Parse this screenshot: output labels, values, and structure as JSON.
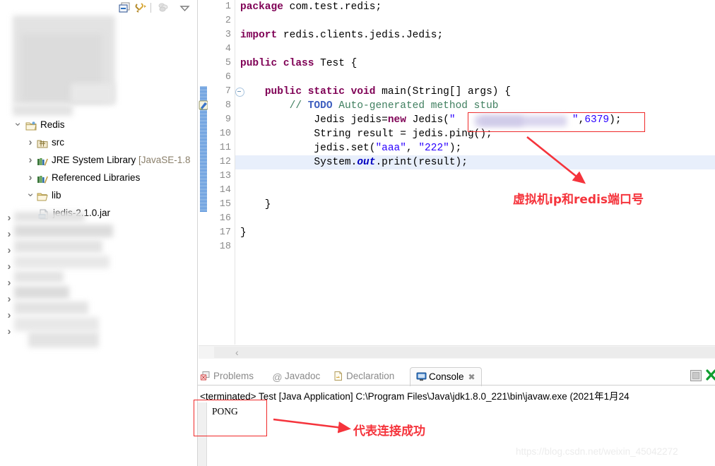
{
  "explorer": {
    "toolbar": [
      {
        "name": "collapse-all-icon",
        "title": "Collapse All"
      },
      {
        "name": "link-with-editor-icon",
        "title": "Link with Editor"
      },
      {
        "name": "filter-icon",
        "title": "Filters"
      },
      {
        "name": "view-menu-icon",
        "title": "View Menu"
      }
    ],
    "tree": [
      {
        "label": "",
        "icon": "folder-icon",
        "state": "redacted",
        "indent": 0,
        "redacted": true
      },
      {
        "label": "",
        "icon": "folder-icon",
        "state": "redacted",
        "indent": 0,
        "redacted": true
      },
      {
        "label": "",
        "icon": "folder-icon",
        "state": "redacted",
        "indent": 0,
        "redacted": true
      },
      {
        "label": "",
        "icon": "folder-icon",
        "state": "redacted",
        "indent": 0,
        "redacted": true
      },
      {
        "label": "",
        "icon": "folder-icon",
        "state": "redacted",
        "indent": 0,
        "redacted": true
      },
      {
        "label": "Redis",
        "icon": "java-project-icon",
        "state": "open",
        "indent": 0,
        "redacted": false
      },
      {
        "label": "src",
        "icon": "source-folder-icon",
        "state": "closed",
        "indent": 1,
        "redacted": false
      },
      {
        "label": "JRE System Library",
        "suffix": " [JavaSE-1.8",
        "icon": "library-icon",
        "state": "closed",
        "indent": 1,
        "redacted": false
      },
      {
        "label": "Referenced Libraries",
        "icon": "library-icon",
        "state": "closed",
        "indent": 1,
        "redacted": false
      },
      {
        "label": "lib",
        "icon": "folder-open-icon",
        "state": "open",
        "indent": 1,
        "redacted": false
      },
      {
        "label": "jedis-2.1.0.jar",
        "icon": "jar-icon",
        "state": "leaf",
        "indent": 2,
        "redacted": false
      },
      {
        "label": "",
        "icon": "folder-icon",
        "state": "closed",
        "indent": 0,
        "redacted": true
      },
      {
        "label": "",
        "icon": "folder-icon",
        "state": "closed",
        "indent": 0,
        "redacted": true
      },
      {
        "label": "",
        "icon": "folder-icon",
        "state": "closed",
        "indent": 0,
        "redacted": true
      },
      {
        "label": "",
        "icon": "folder-icon",
        "state": "closed",
        "indent": 0,
        "redacted": true
      },
      {
        "label": "",
        "icon": "folder-icon",
        "state": "closed",
        "indent": 0,
        "redacted": true
      },
      {
        "label": "",
        "icon": "folder-icon",
        "state": "closed",
        "indent": 0,
        "redacted": true
      },
      {
        "label": "",
        "icon": "folder-icon",
        "state": "closed",
        "indent": 0,
        "redacted": true
      },
      {
        "label": "",
        "icon": "folder-icon",
        "state": "closed",
        "indent": 0,
        "redacted": true
      }
    ]
  },
  "editor": {
    "line_numbers": [
      "1",
      "2",
      "3",
      "4",
      "5",
      "6",
      "7",
      "8",
      "9",
      "10",
      "11",
      "12",
      "13",
      "14",
      "15",
      "16",
      "17",
      "18"
    ],
    "current_line": 12,
    "lines": [
      {
        "n": 1,
        "html": "<span class=\"kw\">package</span> com.test.redis;"
      },
      {
        "n": 2,
        "html": ""
      },
      {
        "n": 3,
        "html": "<span class=\"kw\">import</span> redis.clients.jedis.Jedis;"
      },
      {
        "n": 4,
        "html": ""
      },
      {
        "n": 5,
        "html": "<span class=\"kw\">public</span> <span class=\"kw\">class</span> Test {"
      },
      {
        "n": 6,
        "html": ""
      },
      {
        "n": 7,
        "html": "    <span class=\"kw\">public</span> <span class=\"kw\">static</span> <span class=\"kw\">void</span> main(String[] args) {"
      },
      {
        "n": 8,
        "html": "        <span class=\"cmt\">// <b>TODO</b> Auto-generated method stub</span>"
      },
      {
        "n": 9,
        "html": "            Jedis jedis=<span class=\"kw\">new</span> Jedis(<span class=\"str\">\"                   \"</span>,<span class=\"str\">6379</span>);"
      },
      {
        "n": 10,
        "html": "            String result = jedis.ping();"
      },
      {
        "n": 11,
        "html": "            jedis.set(<span class=\"str\">\"aaa\"</span>, <span class=\"str\">\"222\"</span>);"
      },
      {
        "n": 12,
        "html": "            System.<span class=\"fld\">out</span>.print(result);"
      },
      {
        "n": 13,
        "html": ""
      },
      {
        "n": 14,
        "html": ""
      },
      {
        "n": 15,
        "html": "    }"
      },
      {
        "n": 16,
        "html": ""
      },
      {
        "n": 17,
        "html": "}"
      },
      {
        "n": 18,
        "html": ""
      }
    ],
    "redacted_value": "virtual-machine-ip-address",
    "port": "6379"
  },
  "console": {
    "tabs": [
      {
        "label": "Problems",
        "icon": "problems-icon",
        "active": false,
        "closable": false
      },
      {
        "label": "Javadoc",
        "icon": "javadoc-icon",
        "active": false,
        "closable": false
      },
      {
        "label": "Declaration",
        "icon": "declaration-icon",
        "active": false,
        "closable": false
      },
      {
        "label": "Console",
        "icon": "console-icon",
        "active": true,
        "closable": true
      }
    ],
    "status_line": "<terminated> Test [Java Application] C:\\Program Files\\Java\\jdk1.8.0_221\\bin\\javaw.exe (2021年1月24",
    "output": "PONG",
    "buttons": [
      {
        "name": "minimize-button",
        "label": ""
      },
      {
        "name": "close-button",
        "label": ""
      }
    ]
  },
  "annotations": {
    "code_note": "虚拟机ip和redis端口号",
    "console_note": "代表连接成功",
    "accent_color": "#f5343c"
  },
  "watermark": "https://blog.csdn.net/weixin_45042272"
}
